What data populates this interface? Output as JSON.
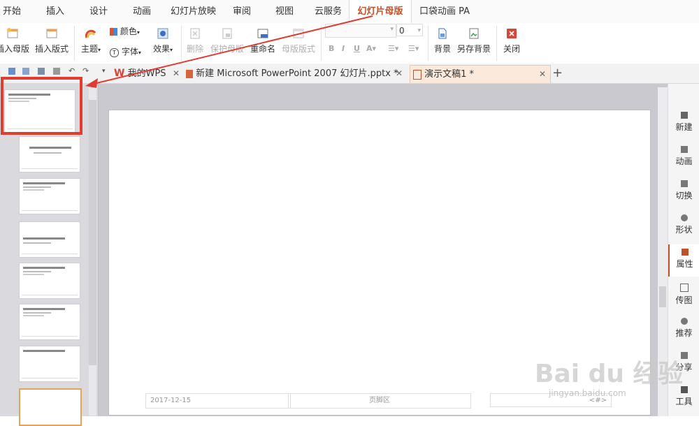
{
  "menu": {
    "tabs": [
      "开始",
      "插入",
      "设计",
      "动画",
      "幻灯片放映",
      "审阅",
      "视图",
      "云服务",
      "幻灯片母版",
      "口袋动画 PA"
    ],
    "active_index": 8
  },
  "ribbon": {
    "insert_master": "插入母版",
    "insert_layout": "插入版式",
    "theme": "主题",
    "color": "颜色",
    "font": "字体",
    "effect": "效果",
    "delete": "删除",
    "protect_master": "保护母版",
    "rename": "重命名",
    "master_layout": "母版版式",
    "font_size_value": "0",
    "background": "背景",
    "save_background": "另存背景",
    "close": "关闭"
  },
  "doc_tabs": [
    {
      "label": "我的WPS",
      "active": false
    },
    {
      "label": "新建 Microsoft PowerPoint 2007 幻灯片.pptx *",
      "active": false
    },
    {
      "label": "演示文稿1 *",
      "active": true
    }
  ],
  "slide": {
    "date": "2017-12-15",
    "footer": "页脚区",
    "page_num": "<#>"
  },
  "sidebar": [
    "新建",
    "动画",
    "切换",
    "形状",
    "属性",
    "传图",
    "推荐",
    "分享",
    "工具"
  ],
  "colors": {
    "accent": "#c0522a",
    "annotation": "#e03c31",
    "close_red": "#d9443a"
  },
  "watermark": {
    "logo": "Bai du 经验",
    "url": "jingyan.baidu.com"
  }
}
